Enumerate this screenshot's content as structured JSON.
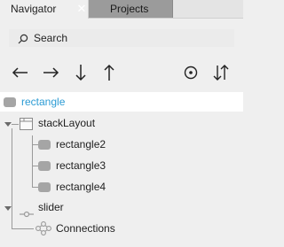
{
  "tabs": {
    "navigator_label": "Navigator",
    "projects_label": "Projects",
    "close_glyph": "✕"
  },
  "search": {
    "placeholder": "Search"
  },
  "toolbar": {
    "icons": [
      "arrow-left-icon",
      "arrow-right-icon",
      "arrow-down-icon",
      "arrow-up-icon",
      "visibility-icon",
      "sort-icon"
    ]
  },
  "tree": {
    "root": {
      "label": "rectangle",
      "selected": true
    },
    "items": [
      {
        "label": "stackLayout",
        "type": "layout"
      },
      {
        "label": "rectangle2",
        "type": "rectangle"
      },
      {
        "label": "rectangle3",
        "type": "rectangle"
      },
      {
        "label": "rectangle4",
        "type": "rectangle"
      },
      {
        "label": "slider",
        "type": "slider"
      },
      {
        "label": "Connections",
        "type": "connections"
      }
    ]
  },
  "colors": {
    "selected_text": "#2b9bd4",
    "panel_bg": "#efefef",
    "inactive_tab_bg": "#9b9b9b"
  }
}
